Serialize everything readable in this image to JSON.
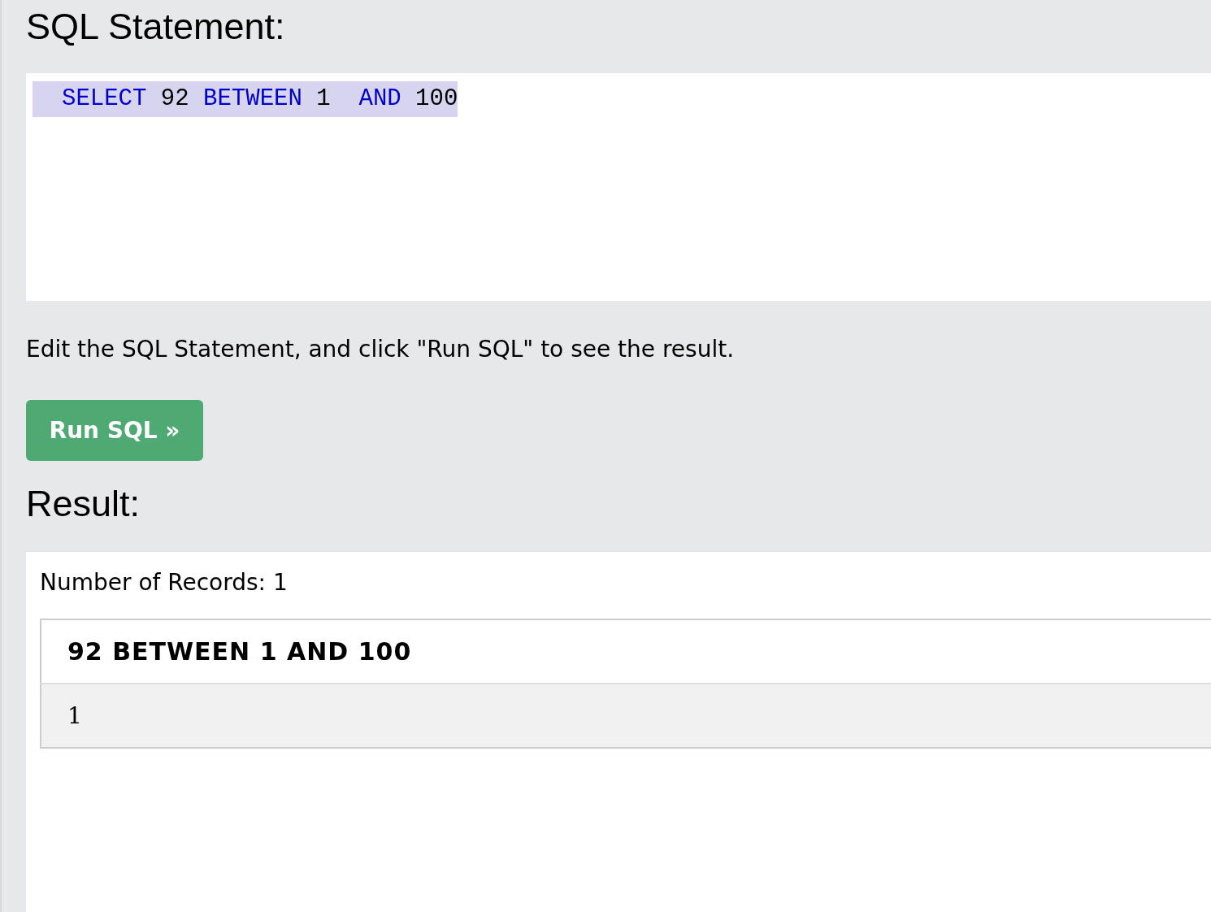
{
  "statement_heading": "SQL Statement:",
  "editor": {
    "lines": [
      {
        "selected": true,
        "tokens": [
          {
            "kind": "keyword",
            "text": "SELECT"
          },
          {
            "kind": "plain",
            "text": " 92 "
          },
          {
            "kind": "keyword",
            "text": "BETWEEN"
          },
          {
            "kind": "plain",
            "text": " 1  "
          },
          {
            "kind": "keyword",
            "text": "AND"
          },
          {
            "kind": "plain",
            "text": " 100"
          }
        ]
      }
    ]
  },
  "instruction": "Edit the SQL Statement, and click \"Run SQL\" to see the result.",
  "run_button": "Run SQL »",
  "result_heading": "Result:",
  "result": {
    "record_count": "Number of Records: 1",
    "columns": [
      "92 BETWEEN 1 AND 100"
    ],
    "rows": [
      [
        "1"
      ]
    ]
  }
}
